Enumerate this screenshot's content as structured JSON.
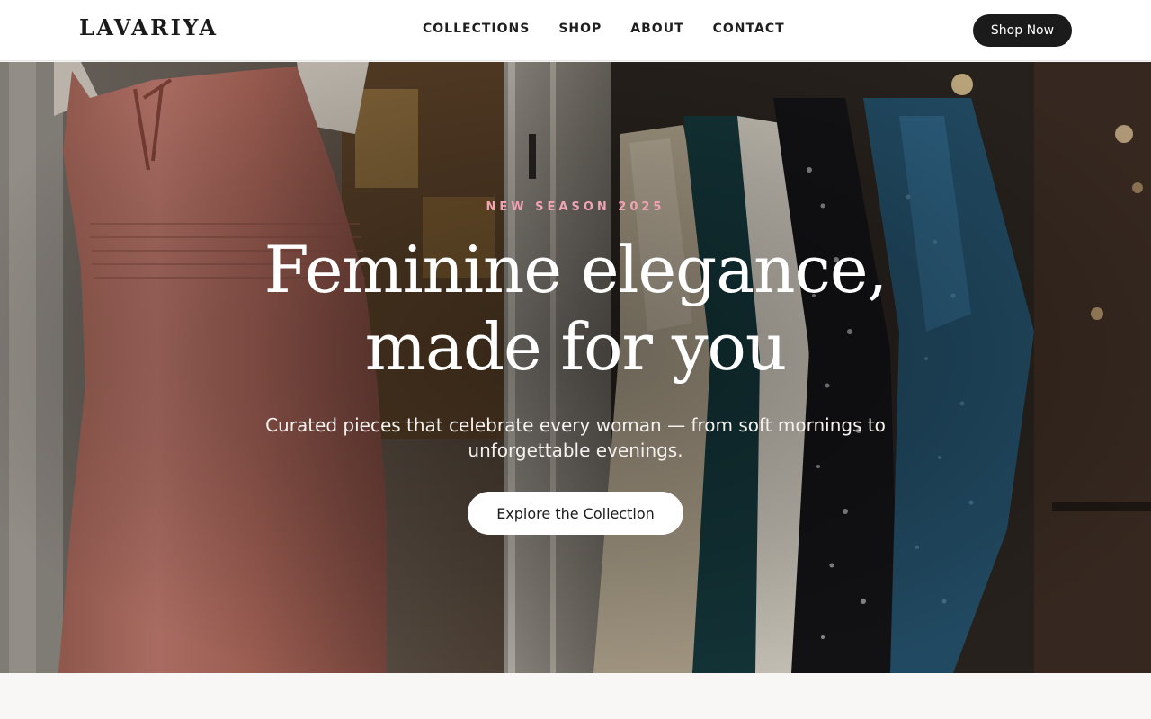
{
  "brand": {
    "name": "LAVARIYA"
  },
  "nav": {
    "links": [
      "COLLECTIONS",
      "SHOP",
      "ABOUT",
      "CONTACT"
    ],
    "cta_label": "Shop Now"
  },
  "hero": {
    "eyebrow": "NEW SEASON 2025",
    "headline_line1": "Feminine elegance,",
    "headline_line2": "made for you",
    "subtitle": "Curated pieces that celebrate every woman — from soft mornings to unforgettable evenings.",
    "cta_label": "Explore the Collection"
  },
  "colors": {
    "nav_button_bg": "#1b1b1b",
    "eyebrow_accent": "#f2a3b3",
    "cta_bg": "#ffffff"
  }
}
